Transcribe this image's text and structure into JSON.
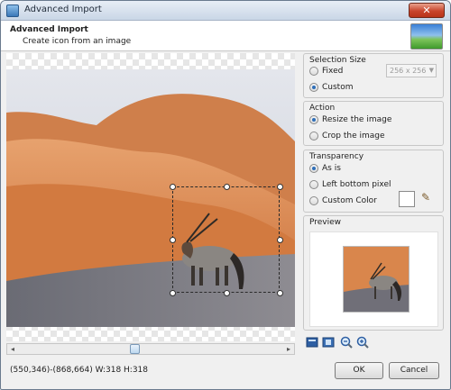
{
  "window": {
    "title": "Advanced Import",
    "close_label": "✕"
  },
  "header": {
    "title": "Advanced Import",
    "subtitle": "Create icon from an image"
  },
  "selection_size": {
    "label": "Selection Size",
    "fixed_label": "Fixed",
    "custom_label": "Custom",
    "selected": "custom",
    "size_value": "256 x 256"
  },
  "action": {
    "label": "Action",
    "resize_label": "Resize the image",
    "crop_label": "Crop the image",
    "selected": "resize"
  },
  "transparency": {
    "label": "Transparency",
    "as_is_label": "As is",
    "left_bottom_label": "Left bottom pixel",
    "custom_color_label": "Custom Color",
    "selected": "as_is",
    "custom_color": "#ffffff"
  },
  "preview": {
    "label": "Preview"
  },
  "scrollbar": {
    "left_arrow": "◂",
    "right_arrow": "▸"
  },
  "status": {
    "text": "(550,346)-(868,664) W:318 H:318"
  },
  "buttons": {
    "ok_label": "OK",
    "cancel_label": "Cancel"
  },
  "icons": {
    "app": "app-icon",
    "header": "wallpaper-thumbnail-icon",
    "eyedropper": "eyedropper-icon",
    "tools": [
      "fit-to-window-icon",
      "actual-size-icon",
      "zoom-out-icon",
      "zoom-in-icon"
    ]
  },
  "colors": {
    "accent": "#2f6fb8",
    "desert_sand": "#d98a52",
    "sky": "#cfd6e0"
  }
}
